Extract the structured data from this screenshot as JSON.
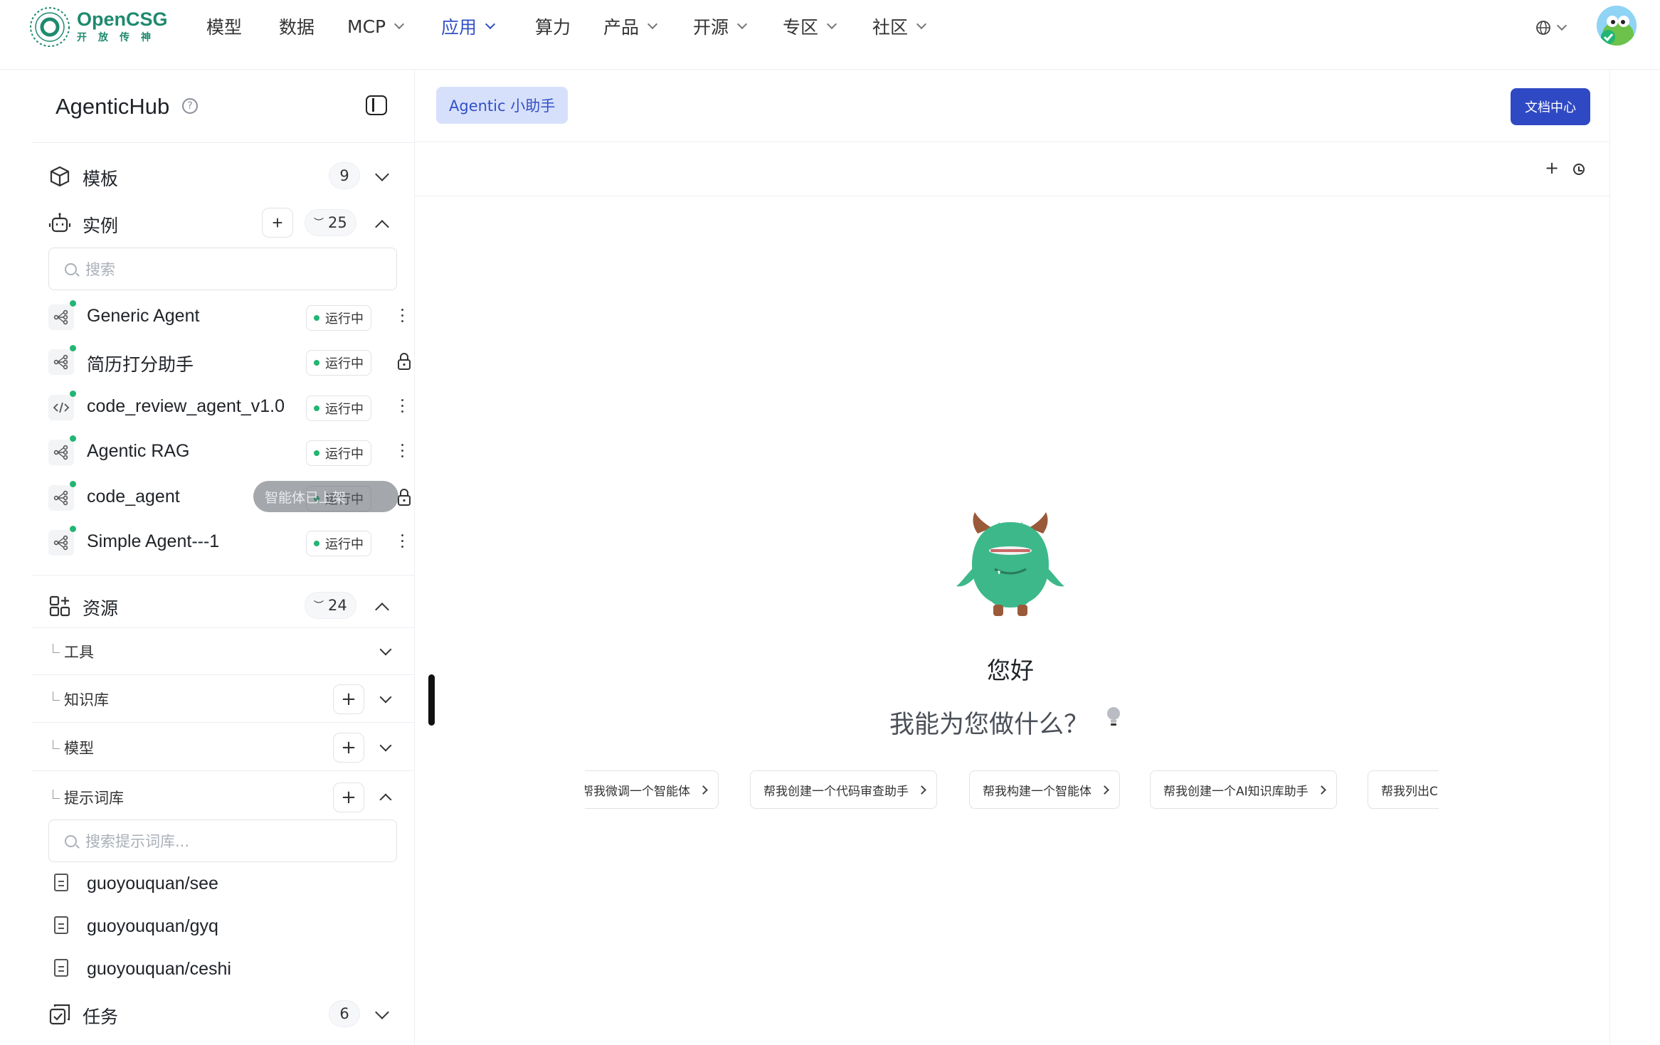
{
  "nav": {
    "logo_name": "OpenCSG",
    "logo_sub": "开放传神",
    "items": [
      {
        "label": "模型",
        "dropdown": false
      },
      {
        "label": "数据",
        "dropdown": false
      },
      {
        "label": "MCP",
        "dropdown": true
      },
      {
        "label": "应用",
        "dropdown": true,
        "active": true
      },
      {
        "label": "算力",
        "dropdown": false
      },
      {
        "label": "产品",
        "dropdown": true
      },
      {
        "label": "开源",
        "dropdown": true
      },
      {
        "label": "专区",
        "dropdown": true
      },
      {
        "label": "社区",
        "dropdown": true
      }
    ]
  },
  "sidebar": {
    "title": "AgenticHub",
    "help": "?",
    "templates": {
      "label": "模板",
      "count": "9"
    },
    "instances": {
      "label": "实例",
      "add": "+",
      "count": "25",
      "search_placeholder": "搜索",
      "items": [
        {
          "name": "Generic Agent",
          "status": "运行中",
          "action": "more",
          "icon": "workflow-icon"
        },
        {
          "name": "简历打分助手",
          "status": "运行中",
          "action": "lock",
          "icon": "workflow-icon"
        },
        {
          "name": "code_review_agent_v1.0",
          "status": "运行中",
          "action": "more",
          "icon": "code-icon"
        },
        {
          "name": "Agentic RAG",
          "status": "运行中",
          "action": "more",
          "icon": "workflow-icon"
        },
        {
          "name": "code_agent",
          "status": "运行中",
          "action": "lock",
          "icon": "workflow-icon"
        },
        {
          "name": "Simple Agent---1",
          "status": "运行中",
          "action": "more",
          "icon": "workflow-icon"
        }
      ],
      "tooltip": "智能体已上架"
    },
    "resources": {
      "label": "资源",
      "count": "24",
      "items": [
        {
          "label": "工具",
          "add": false,
          "expanded": false
        },
        {
          "label": "知识库",
          "add": true,
          "expanded": false
        },
        {
          "label": "模型",
          "add": true,
          "expanded": false
        },
        {
          "label": "提示词库",
          "add": true,
          "expanded": true
        }
      ],
      "prompt_search_placeholder": "搜索提示词库...",
      "prompts": [
        "guoyouquan/see",
        "guoyouquan/gyq",
        "guoyouquan/ceshi"
      ]
    },
    "tasks": {
      "label": "任务",
      "count": "6"
    }
  },
  "main": {
    "tab": "Agentic 小助手",
    "doc_button": "文档中心",
    "new": "+",
    "greeting": "您好",
    "question": "我能为您做什么？",
    "suggestions": [
      "帮我微调一个智能体",
      "帮我创建一个代码审查助手",
      "帮我构建一个智能体",
      "帮我创建一个AI知识库助手",
      "帮我列出C"
    ]
  },
  "colors": {
    "accent": "#3250c7",
    "brand": "#1e8a6e",
    "running": "#22b573",
    "mascot": "#3cb88a"
  }
}
